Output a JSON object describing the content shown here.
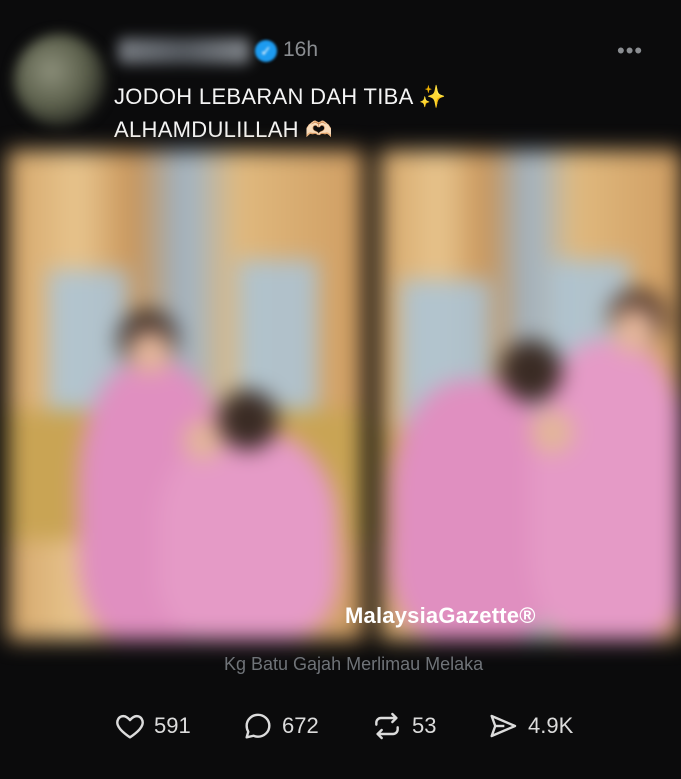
{
  "post": {
    "time": "16h",
    "more_label": "•••",
    "caption_line1": "JODOH LEBARAN DAH TIBA ✨",
    "caption_line2": "ALHAMDULILLAH 🫶🏻",
    "watermark": "MalaysiaGazette®",
    "location": "Kg Batu Gajah Merlimau Melaka"
  },
  "actions": {
    "likes": "591",
    "comments": "672",
    "reposts": "53",
    "shares": "4.9K"
  },
  "colors": {
    "background": "#0b0b0c",
    "verified": "#1d9bf0",
    "muted_text": "#8a8d91",
    "outfit_pink": "#e08fc0"
  },
  "icons": [
    "heart-icon",
    "comment-icon",
    "repost-icon",
    "share-icon",
    "verified-badge-icon",
    "more-icon"
  ]
}
